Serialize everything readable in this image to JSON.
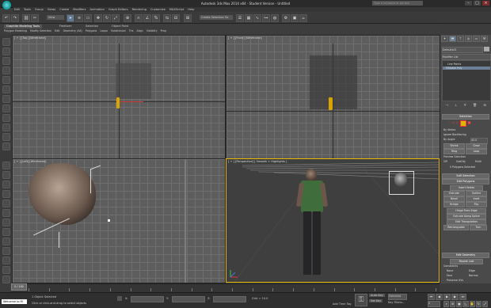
{
  "window": {
    "title": "Autodesk 3ds Max 2014 x64 - Student Version - Untitled",
    "help_search": "Type a keyword or phrase"
  },
  "menu": [
    "Edit",
    "Tools",
    "Group",
    "Views",
    "Create",
    "Modifiers",
    "Animation",
    "Graph Editors",
    "Rendering",
    "Customize",
    "MAXScript",
    "Help"
  ],
  "toolbar": {
    "view_dropdown": "View",
    "selection_set_placeholder": "Create Selection Se"
  },
  "ribbon": {
    "tabs": [
      "Graphite Modeling Tools",
      "Freeform",
      "Selection",
      "Object Paint"
    ],
    "sub_items": [
      "Polygon Modeling",
      "Modify Selection",
      "Edit",
      "Geometry (All)",
      "Polygons",
      "Loops",
      "Subdivision",
      "Tris",
      "Align",
      "Visibility",
      "Prop"
    ]
  },
  "viewports": {
    "top_label": "[ + ] [Top] [Wireframe]",
    "front_label": "[ + ] [Front] [Wireframe]",
    "left_label": "[ + ] [Left] [Wireframe]",
    "persp_label": "[ + ] [Perspective] [ Smooth + Highlights ]"
  },
  "command_panel": {
    "object_name": "Defaultx01",
    "modifier_list": "Modifier List",
    "stack": [
      "Line Points",
      "Editable Poly"
    ],
    "rollouts": {
      "selection": "Selection",
      "by_vertex": "By Vertex",
      "ignore_backfacing": "Ignore Backfacing",
      "by_angle": "By Angle:",
      "by_angle_value": "45.0",
      "shrink": "Shrink",
      "grow": "Grow",
      "ring": "Ring",
      "loop": "Loop",
      "preview_selection": "Preview Selection",
      "off": "Off",
      "subobj": "SubObj",
      "multi": "Multi",
      "polygons_selected": "0 Polygons Selected",
      "soft_selection": "Soft Selection",
      "edit_polygons": "Edit Polygons",
      "insert_vertex": "Insert Vertex",
      "extrude": "Extrude",
      "outline": "Outline",
      "bevel": "Bevel",
      "inset": "Inset",
      "bridge": "Bridge",
      "flip": "Flip",
      "hinge_from_edge": "Hinge From Edge",
      "extrude_along_spline": "Extrude Along Spline",
      "edit_triangulation": "Edit Triangulation",
      "retriangulate": "Retriangulate",
      "turn": "Turn",
      "edit_geometry": "Edit Geometry",
      "repeat_last": "Repeat Last",
      "constraints": "Constraints",
      "none": "None",
      "edge": "Edge",
      "face": "Face",
      "normal": "Normal",
      "preserve_uvs": "Preserve UVs"
    }
  },
  "timeline": {
    "slider": "0 / 100",
    "ticks": [
      "0",
      "5",
      "10",
      "15",
      "20",
      "25",
      "30",
      "35",
      "40",
      "45",
      "50",
      "55",
      "60",
      "65",
      "70",
      "75",
      "80",
      "85",
      "90",
      "95",
      "100"
    ]
  },
  "status": {
    "listener": "Welcome to M",
    "selected": "1 Object Selected",
    "prompt": "Click or click-and-drag to select objects",
    "x_label": "X:",
    "y_label": "Y:",
    "z_label": "Z:",
    "grid": "Grid = 10.0",
    "auto_key": "Auto Key",
    "set_key": "Set Key",
    "selected_dd": "Selected",
    "key_filters": "Key Filters...",
    "add_time_tag": "Add Time Tag",
    "frame": "0"
  },
  "colors": {
    "active_viewport_border": "#e6b800",
    "grid_line": "#6f6f6f",
    "selection_highlight": "#5f7a96"
  }
}
